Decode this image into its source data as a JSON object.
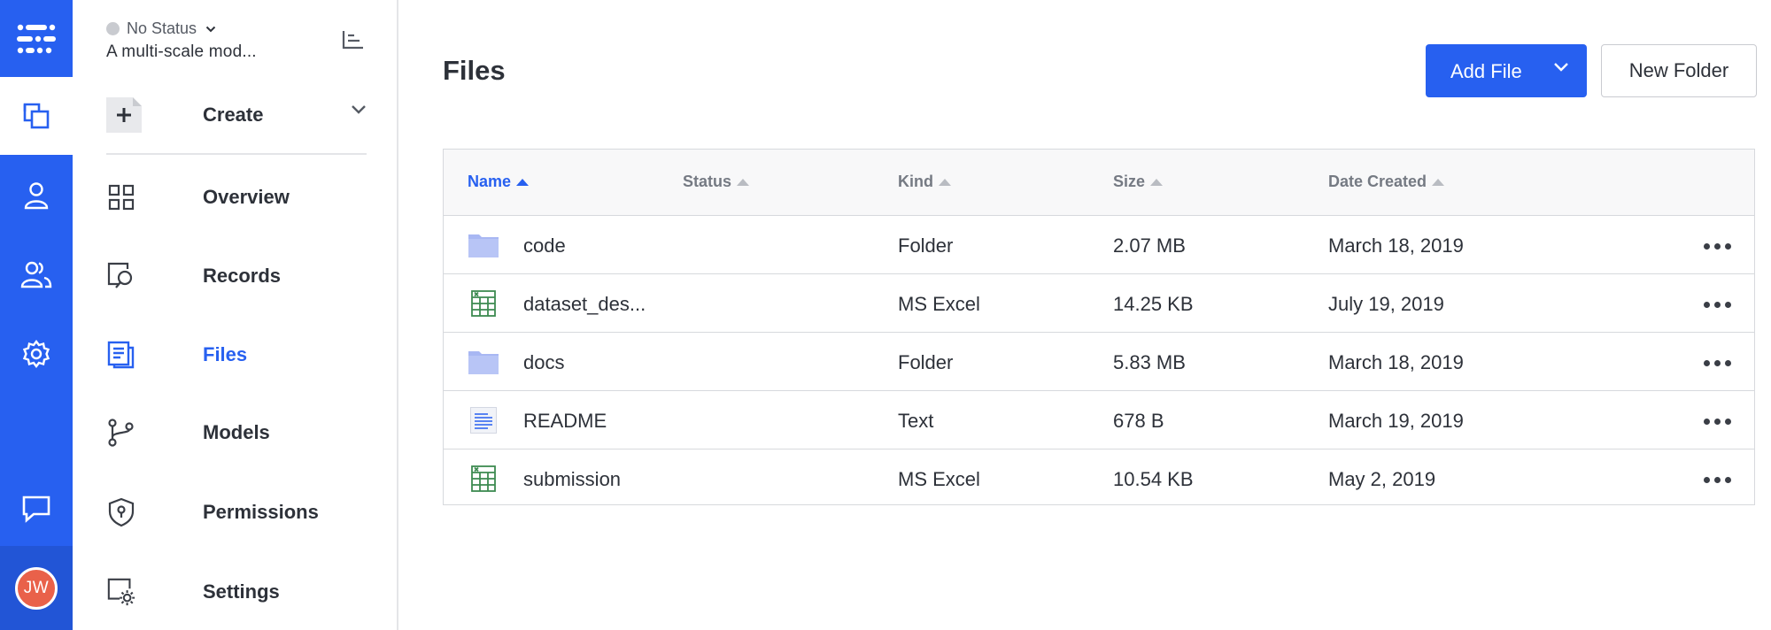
{
  "rail": {
    "items": [
      {
        "icon": "app-logo-icon"
      },
      {
        "icon": "datasets-icon",
        "active": true
      },
      {
        "icon": "user-icon"
      },
      {
        "icon": "team-icon"
      },
      {
        "icon": "gear-icon"
      },
      {
        "icon": "chat-icon"
      }
    ],
    "avatar_initials": "JW",
    "colors": {
      "rail": "#2760f0",
      "avatar": "#e9614a"
    }
  },
  "sidebar": {
    "status": "No Status",
    "project_name": "A multi-scale mod...",
    "create_label": "Create",
    "nav": [
      {
        "label": "Overview",
        "icon": "grid-icon"
      },
      {
        "label": "Records",
        "icon": "records-search-icon"
      },
      {
        "label": "Files",
        "icon": "files-icon",
        "active": true
      },
      {
        "label": "Models",
        "icon": "models-branch-icon"
      },
      {
        "label": "Permissions",
        "icon": "shield-icon"
      },
      {
        "label": "Settings",
        "icon": "settings-gear-icon"
      }
    ]
  },
  "main": {
    "title": "Files",
    "add_file_label": "Add File",
    "new_folder_label": "New Folder",
    "columns": [
      "Name",
      "Status",
      "Kind",
      "Size",
      "Date Created"
    ],
    "sorted_column": "Name",
    "rows": [
      {
        "name": "code",
        "status": "",
        "kind": "Folder",
        "size": "2.07 MB",
        "date": "March 18, 2019",
        "icon": "folder-icon"
      },
      {
        "name": "dataset_des...",
        "status": "",
        "kind": "MS Excel",
        "size": "14.25 KB",
        "date": "July 19, 2019",
        "icon": "excel-icon"
      },
      {
        "name": "docs",
        "status": "",
        "kind": "Folder",
        "size": "5.83 MB",
        "date": "March 18, 2019",
        "icon": "folder-icon"
      },
      {
        "name": "README",
        "status": "",
        "kind": "Text",
        "size": "678 B",
        "date": "March 19, 2019",
        "icon": "text-file-icon"
      },
      {
        "name": "submission",
        "status": "",
        "kind": "MS Excel",
        "size": "10.54 KB",
        "date": "May 2, 2019",
        "icon": "excel-icon"
      }
    ]
  }
}
